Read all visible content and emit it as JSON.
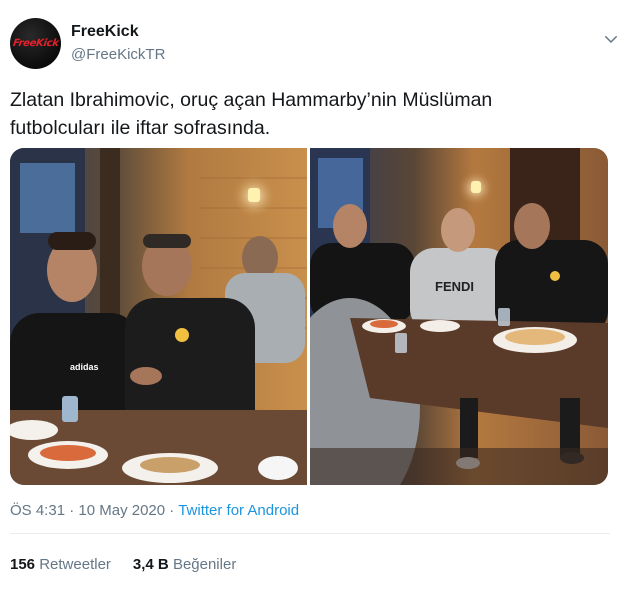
{
  "account": {
    "name": "FreeKick",
    "handle": "@FreeKickTR",
    "avatar_text": "FreeKick"
  },
  "tweet": {
    "text_line1": "Zlatan Ibrahimovic, oruç açan Hammarby’nin Müslüman",
    "text_line2": "futbolcuları ile iftar sofrasında."
  },
  "media": {
    "photo1_jersey_text": "adidas",
    "photo2_sweater_text": "FENDI"
  },
  "meta": {
    "time": "ÖS 4:31",
    "separator1": "·",
    "date": "10 May 2020",
    "separator2": "·",
    "source": "Twitter for Android"
  },
  "stats": {
    "retweets_count": "156",
    "retweets_label": "Retweetler",
    "likes_count": "3,4 B",
    "likes_label": "Beğeniler"
  },
  "colors": {
    "text": "#14171a",
    "secondary": "#657786",
    "link": "#1b95e0",
    "divider": "#e6ecf0",
    "brand_red": "#e5202a"
  },
  "icons": [
    "chevron-down-icon"
  ]
}
